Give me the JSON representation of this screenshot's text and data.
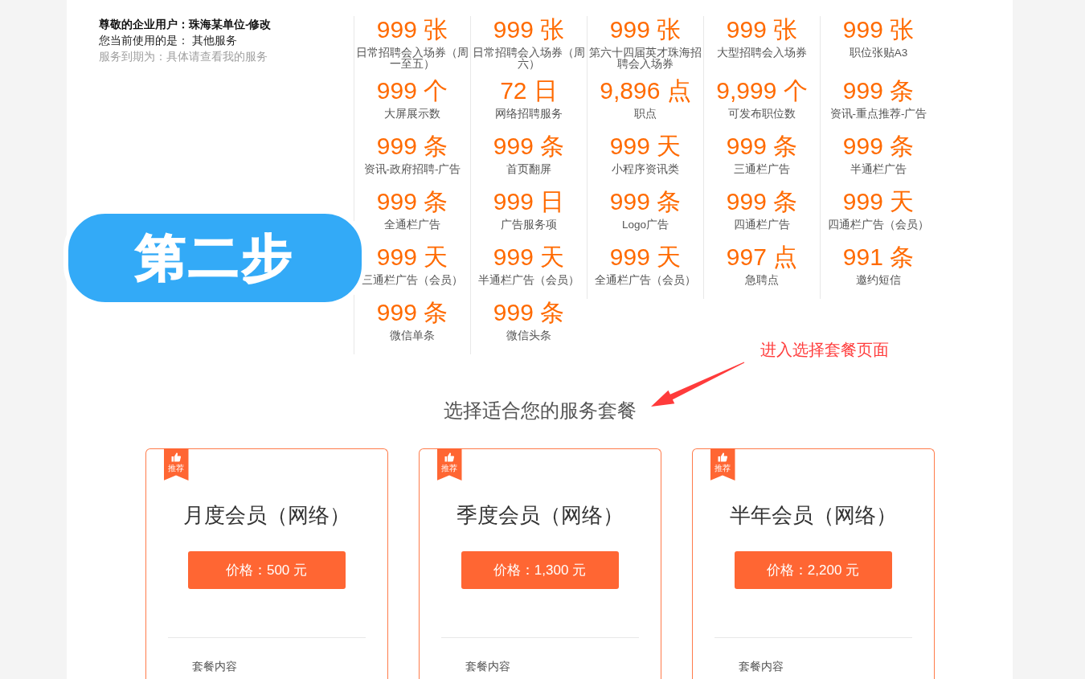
{
  "account": {
    "greeting": "尊敬的企业用户：珠海某单位-修改",
    "current_service": "您当前使用的是： 其他服务",
    "expiry": "服务到期为：具体请查看我的服务"
  },
  "quotas": [
    {
      "value": "999 张",
      "label": "日常招聘会入场券（周一至五）"
    },
    {
      "value": "999 张",
      "label": "日常招聘会入场券（周六）"
    },
    {
      "value": "999 张",
      "label": "第六十四届英才珠海招聘会入场券"
    },
    {
      "value": "999 张",
      "label": "大型招聘会入场券"
    },
    {
      "value": "999 张",
      "label": "职位张贴A3"
    },
    {
      "value": "999 个",
      "label": "大屏展示数"
    },
    {
      "value": "72 日",
      "label": "网络招聘服务"
    },
    {
      "value": "9,896 点",
      "label": "职点"
    },
    {
      "value": "9,999 个",
      "label": "可发布职位数"
    },
    {
      "value": "999 条",
      "label": "资讯-重点推荐-广告"
    },
    {
      "value": "999 条",
      "label": "资讯-政府招聘-广告"
    },
    {
      "value": "999 条",
      "label": "首页翻屏"
    },
    {
      "value": "999 天",
      "label": "小程序资讯类"
    },
    {
      "value": "999 条",
      "label": "三通栏广告"
    },
    {
      "value": "999 条",
      "label": "半通栏广告"
    },
    {
      "value": "999 条",
      "label": "全通栏广告"
    },
    {
      "value": "999 日",
      "label": "广告服务项"
    },
    {
      "value": "999 条",
      "label": "Logo广告"
    },
    {
      "value": "999 条",
      "label": "四通栏广告"
    },
    {
      "value": "999 天",
      "label": "四通栏广告（会员）"
    },
    {
      "value": "999 天",
      "label": "三通栏广告（会员）"
    },
    {
      "value": "999 天",
      "label": "半通栏广告（会员）"
    },
    {
      "value": "999 天",
      "label": "全通栏广告（会员）"
    },
    {
      "value": "997 点",
      "label": "急聘点"
    },
    {
      "value": "991 条",
      "label": "邀约短信"
    },
    {
      "value": "999 条",
      "label": "微信单条"
    },
    {
      "value": "999 条",
      "label": "微信头条"
    }
  ],
  "step_badge": {
    "text": "第二步"
  },
  "annotation": {
    "text": "进入选择套餐页面"
  },
  "packages": {
    "title": "选择适合您的服务套餐",
    "items": [
      {
        "tag": "推荐",
        "name": "月度会员（网络）",
        "price": "价格：500 元",
        "contents_label": "套餐内容"
      },
      {
        "tag": "推荐",
        "name": "季度会员（网络）",
        "price": "价格：1,300 元",
        "contents_label": "套餐内容"
      },
      {
        "tag": "推荐",
        "name": "半年会员（网络）",
        "price": "价格：2,200 元",
        "contents_label": "套餐内容"
      }
    ]
  }
}
